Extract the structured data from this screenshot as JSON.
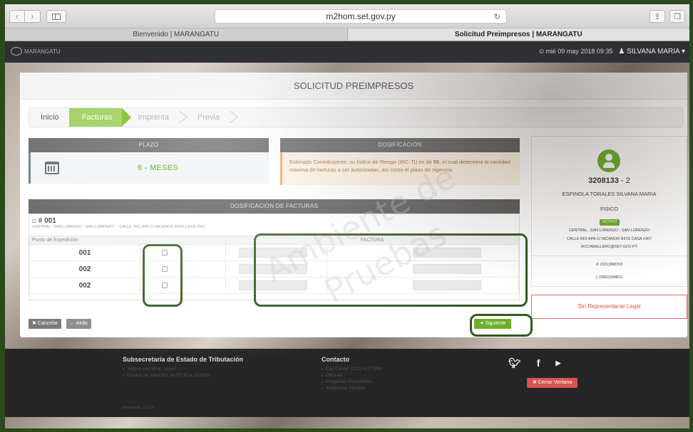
{
  "browser": {
    "url": "m2hom.set.gov.py",
    "tabs": [
      "Bienvenido | MARANGATU",
      "Solicitud Preimpresos | MARANGATU"
    ]
  },
  "header": {
    "logo_text": "MARANGATU",
    "datetime": "mié 09 may 2018 09:35",
    "user": "SILVANA MARIA"
  },
  "page": {
    "title": "SOLICITUD PREIMPRESOS",
    "steps": [
      "Inicio",
      "Facturas",
      "Imprenta",
      "Previa"
    ],
    "active_step": 1
  },
  "plazo": {
    "heading": "PLAZO",
    "value": "6 - MESES"
  },
  "dosificacion": {
    "heading": "DOSIFICACIÓN",
    "text_pre": "Estimado Contribuyente, su Índice de Riesgo (IRC-TI) es de ",
    "risk": "50",
    "text_post": ", el cual determina la cantidad máxima de facturas a ser autorizadas, así como el plazo de vigencia."
  },
  "facturas": {
    "heading": "DOSIFICACIÓN DE FACTURAS",
    "establecimiento": "# 001",
    "address": "CENTRAL - SAN LORENZO - SAN LORENZO - - CALLE, RIO APA C/ NICANOR RIOS CASA #367",
    "col_punto": "Punto de Expedición",
    "col_factura": "FACTURA",
    "rows": [
      {
        "punto": "001"
      },
      {
        "punto": "002"
      },
      {
        "punto": "002"
      }
    ]
  },
  "contribuyente": {
    "ruc": "3208133",
    "dv": " - 2",
    "name": "ESPINOLA TORALES SILVANA MARIA",
    "type": "FISICO",
    "status": "ACTIVO",
    "address1": "CENTRAL , SAN LORENZO , SAN LORENZO",
    "address2": "CALLE RIO APA C/ NICANOR RIOS CASA #367",
    "email": "CCABALLERO@SET.GOV.PY",
    "phone": "(021)968703",
    "mobile": "(0982)998811",
    "representante": "Sin Representante Legal"
  },
  "actions": {
    "cancel": "✖ Cancelar",
    "back": "← Atrás",
    "next": "➔ Siguiente"
  },
  "footer": {
    "col1_title": "Subsecretaria de Estado de Tributación",
    "col1_items": [
      "Yegros esq Mcal. Lopez",
      "Horario de Atención: de 07:30 a 13:00hs"
    ],
    "col2_title": "Contacto",
    "col2_items": [
      "Call Center (021) 417 7000",
      "Oficinas",
      "Preguntas Frecuentes",
      "Asistencia Técnica"
    ],
    "close": "✖ Cerrar Ventana",
    "version": "Marangatu 2.0.0.4"
  },
  "watermark": [
    "Ambiente de",
    "Pruebas"
  ]
}
